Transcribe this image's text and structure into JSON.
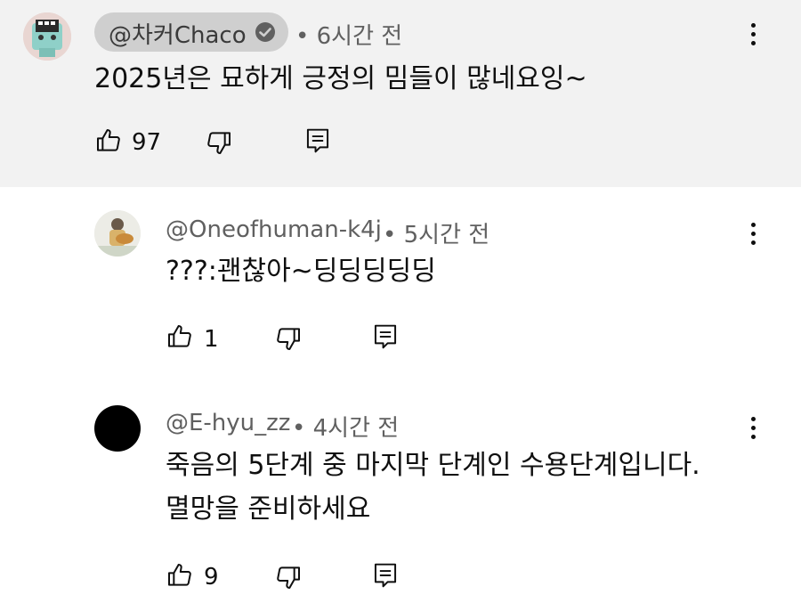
{
  "comments": [
    {
      "handle": "@차커Chaco",
      "verified": true,
      "time": "• 6시간 전",
      "text_lines": [
        "2025년은 묘하게 긍정의 밈들이 많네요잉~"
      ],
      "likes": "97",
      "highlighted": true
    },
    {
      "handle": "@Oneofhuman-k4j",
      "time": "• 5시간 전",
      "text_lines": [
        "???:괜찮아~딩딩딩딩딩"
      ],
      "likes": "1"
    },
    {
      "handle": "@E-hyu_zz",
      "time": "• 4시간 전",
      "text_lines": [
        "죽음의 5단계 중 마지막 단계인 수용단계입니다.",
        "멸망을 준비하세요"
      ],
      "likes": "9"
    }
  ],
  "icons": [
    "thumb-up-icon",
    "thumb-down-icon",
    "reply-icon",
    "more-vert-icon",
    "verified-check-icon"
  ],
  "colors": {
    "highlight_bg": "#f2f2f2",
    "owner_pill": "#cfcfcf",
    "meta_text": "#606060",
    "text": "#0f0f0f"
  }
}
